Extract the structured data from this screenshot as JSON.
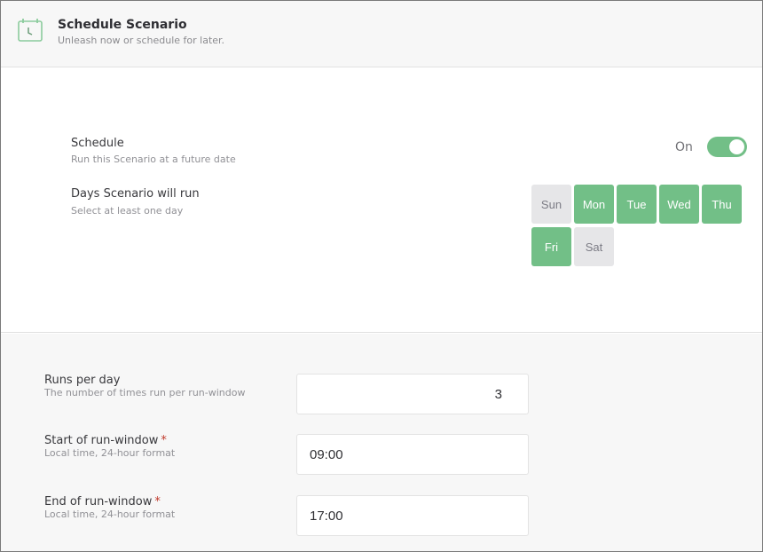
{
  "header": {
    "icon": "calendar-clock-icon",
    "title": "Schedule Scenario",
    "subtitle": "Unleash now or schedule for later."
  },
  "schedule": {
    "label": "Schedule",
    "description": "Run this Scenario at a future date",
    "toggle_label": "On",
    "toggle_on": true
  },
  "days": {
    "label": "Days Scenario will run",
    "description": "Select at least one day",
    "items": [
      {
        "label": "Sun",
        "selected": false
      },
      {
        "label": "Mon",
        "selected": true
      },
      {
        "label": "Tue",
        "selected": true
      },
      {
        "label": "Wed",
        "selected": true
      },
      {
        "label": "Thu",
        "selected": true
      },
      {
        "label": "Fri",
        "selected": true
      },
      {
        "label": "Sat",
        "selected": false
      }
    ]
  },
  "runs_per_day": {
    "label": "Runs per day",
    "description": "The number of times run per run-window",
    "value": "3"
  },
  "start_window": {
    "label": "Start of run-window",
    "required_mark": "*",
    "description": "Local time, 24-hour format",
    "value": "09:00"
  },
  "end_window": {
    "label": "End of run-window",
    "required_mark": "*",
    "description": "Local time, 24-hour format",
    "value": "17:00"
  },
  "colors": {
    "accent": "#72bf87",
    "day_off": "#e6e6e8",
    "required": "#c0392b"
  }
}
